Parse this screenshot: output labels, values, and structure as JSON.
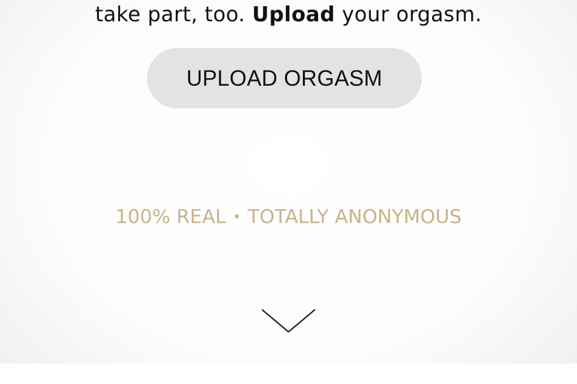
{
  "intro": {
    "before": "take part, too. ",
    "emphasis": "Upload",
    "after": " your orgasm."
  },
  "upload_button": {
    "label": "UPLOAD ORGASM"
  },
  "tagline": {
    "part1": "100% REAL",
    "separator": "•",
    "part2": "TOTALLY ANONYMOUS"
  },
  "icons": {
    "scroll": "chevron-down-icon"
  },
  "colors": {
    "text": "#111111",
    "button_bg": "#e3e3e3",
    "tagline_gold": "#c8b28a",
    "chevron": "#1a1a1a"
  }
}
